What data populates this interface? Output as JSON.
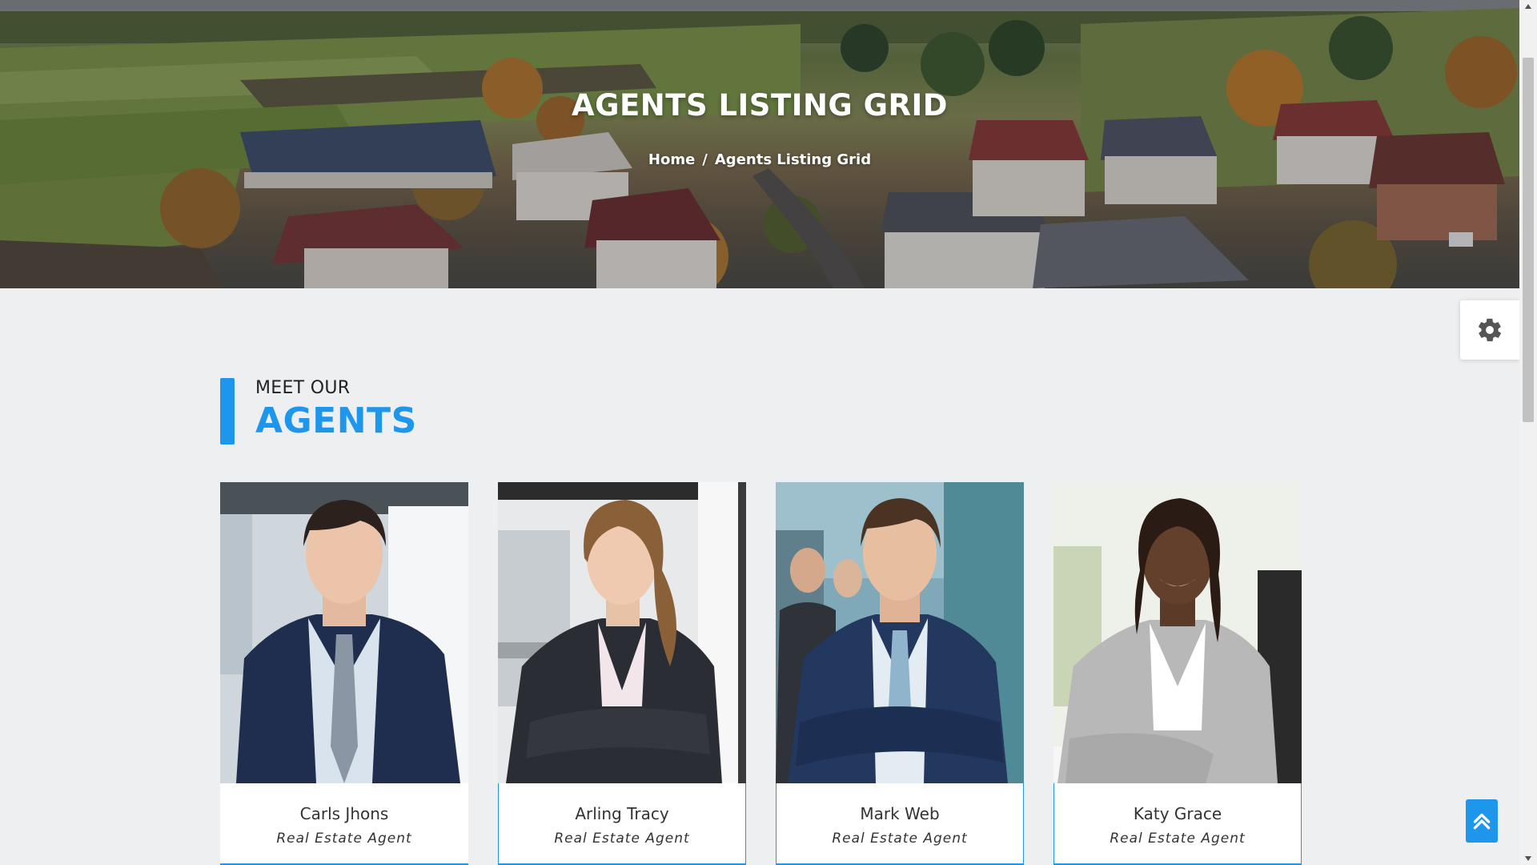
{
  "hero": {
    "title": "AGENTS LISTING GRID",
    "breadcrumb": {
      "home": "Home",
      "separator": "/",
      "current": "Agents Listing Grid"
    }
  },
  "section": {
    "eyebrow": "MEET OUR",
    "title": "AGENTS"
  },
  "agents": [
    {
      "name": "Carls Jhons",
      "role": "Real Estate Agent"
    },
    {
      "name": "Arling Tracy",
      "role": "Real Estate Agent"
    },
    {
      "name": "Mark Web",
      "role": "Real Estate Agent"
    },
    {
      "name": "Katy Grace",
      "role": "Real Estate Agent"
    }
  ],
  "icons": {
    "settings": "gear-icon",
    "back_to_top": "double-chevron-up-icon",
    "scroll_up": "triangle-up-icon",
    "scroll_down": "triangle-down-icon"
  },
  "colors": {
    "accent": "#1e96ec",
    "page_background": "#eeeff1",
    "card_background": "#ffffff",
    "text": "#333333"
  }
}
